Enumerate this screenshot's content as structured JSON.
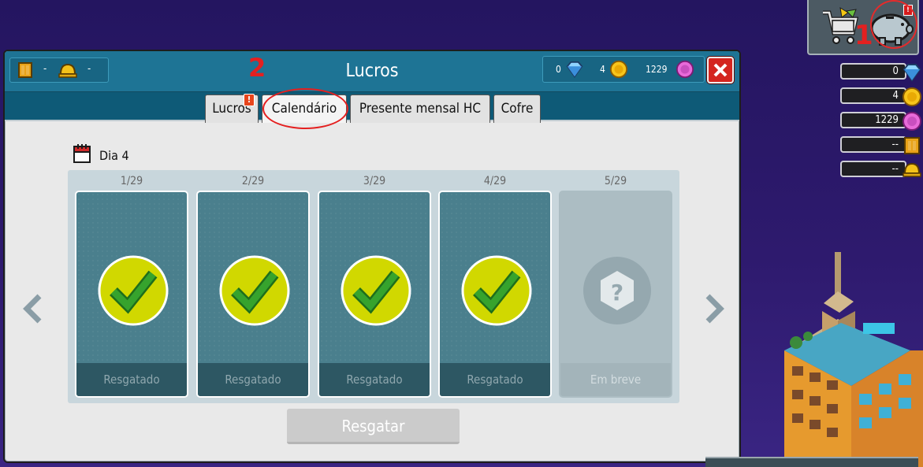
{
  "window": {
    "title": "Lucros",
    "badges": {
      "hc_value": "-",
      "builder_value": "-"
    },
    "wallet": {
      "diamonds": "0",
      "credits": "4",
      "duckets": "1229"
    }
  },
  "annotations": {
    "marker_1": "1",
    "marker_2": "2"
  },
  "tabs": [
    {
      "label": "Lucros",
      "alert": "!"
    },
    {
      "label": "Calendário",
      "active": true
    },
    {
      "label": "Presente mensal HC"
    },
    {
      "label": "Cofre"
    }
  ],
  "calendar": {
    "day_label": "Dia 4",
    "days": [
      {
        "number": "1/29",
        "status": "Resgatado"
      },
      {
        "number": "2/29",
        "status": "Resgatado"
      },
      {
        "number": "3/29",
        "status": "Resgatado"
      },
      {
        "number": "4/29",
        "status": "Resgatado"
      },
      {
        "number": "5/29",
        "status": "Em breve"
      }
    ],
    "claim_label": "Resgatar"
  },
  "shop": {
    "bank_badge": "!"
  },
  "currencies": [
    {
      "value": "0",
      "icon": "diamond-icon"
    },
    {
      "value": "4",
      "icon": "credit-coin-icon"
    },
    {
      "value": "1229",
      "icon": "ducket-icon"
    },
    {
      "value": "--",
      "icon": "hc-icon"
    },
    {
      "value": "--",
      "icon": "builder-helmet-icon"
    }
  ],
  "colors": {
    "titlebar": "#1e7495",
    "tabbar": "#0e5a77",
    "check_circle": "#d1d800",
    "check_mark": "#2f9d2a",
    "annotation_red": "#e42020"
  }
}
